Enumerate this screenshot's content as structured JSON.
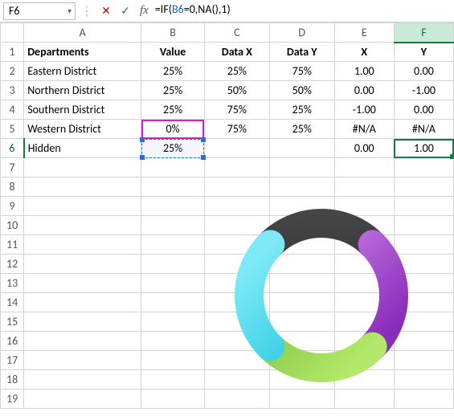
{
  "namebox": {
    "value": "F6"
  },
  "formula": {
    "prefix": "=IF(",
    "ref": "B6",
    "mid": "=0,",
    "fn": "NA",
    "suffix": "(),1)"
  },
  "columns": [
    "A",
    "B",
    "C",
    "D",
    "E",
    "F"
  ],
  "header_row": {
    "A": "Departments",
    "B": "Value",
    "C": "Data X",
    "D": "Data Y",
    "E": "X",
    "F": "Y"
  },
  "rows": [
    {
      "A": "Eastern District",
      "B": "25%",
      "C": "25%",
      "D": "75%",
      "E": "1.00",
      "F": "0.00"
    },
    {
      "A": "Northern District",
      "B": "25%",
      "C": "50%",
      "D": "50%",
      "E": "0.00",
      "F": "-1.00"
    },
    {
      "A": "Southern District",
      "B": "25%",
      "C": "75%",
      "D": "25%",
      "E": "-1.00",
      "F": "0.00"
    },
    {
      "A": "Western District",
      "B": "0%",
      "C": "75%",
      "D": "25%",
      "E": "#N/A",
      "F": "#N/A"
    },
    {
      "A": "Hidden",
      "B": "25%",
      "C": "",
      "D": "",
      "E": "0.00",
      "F": "1.00"
    }
  ],
  "chart_data": {
    "type": "pie",
    "title": "",
    "categories": [
      "Eastern District",
      "Northern District",
      "Southern District",
      "Western District",
      "Hidden"
    ],
    "values": [
      25,
      25,
      25,
      0,
      25
    ],
    "colors": [
      "#1d1d1d",
      "#b84fe0",
      "#7fd13b",
      "#2dd6ef"
    ],
    "note": "Rendered as a doughnut; Western District slice has 0% so four equal arcs are visible."
  }
}
